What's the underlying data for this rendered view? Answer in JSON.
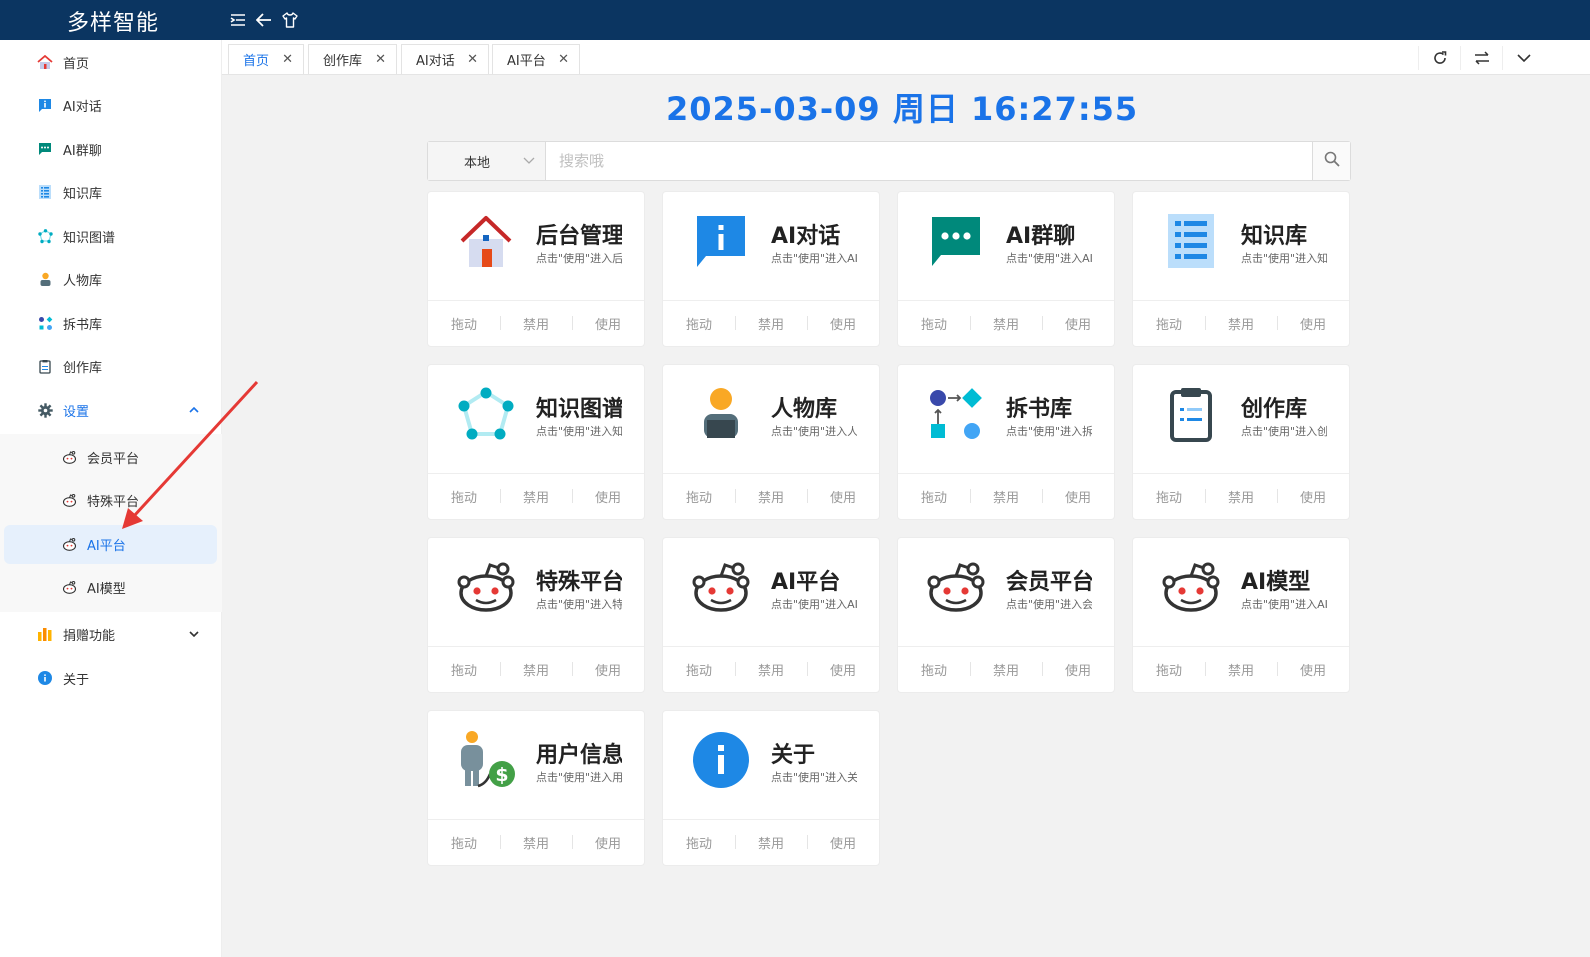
{
  "app": {
    "title": "多样智能"
  },
  "sidebar": {
    "items": [
      {
        "label": "首页",
        "icon": "home-icon"
      },
      {
        "label": "AI对话",
        "icon": "info-chat-icon"
      },
      {
        "label": "AI群聊",
        "icon": "group-chat-icon"
      },
      {
        "label": "知识库",
        "icon": "list-icon"
      },
      {
        "label": "知识图谱",
        "icon": "graph-icon"
      },
      {
        "label": "人物库",
        "icon": "person-icon"
      },
      {
        "label": "拆书库",
        "icon": "flow-icon"
      },
      {
        "label": "创作库",
        "icon": "clipboard-icon"
      },
      {
        "label": "设置",
        "icon": "gear-icon"
      },
      {
        "label": "捐赠功能",
        "icon": "bar-chart-icon"
      },
      {
        "label": "关于",
        "icon": "info-circle-icon"
      }
    ],
    "settings_sub": [
      {
        "label": "会员平台",
        "icon": "reddit-icon"
      },
      {
        "label": "特殊平台",
        "icon": "reddit-icon"
      },
      {
        "label": "AI平台",
        "icon": "reddit-icon"
      },
      {
        "label": "AI模型",
        "icon": "reddit-icon"
      }
    ]
  },
  "tabs": [
    {
      "label": "首页",
      "close": "✕"
    },
    {
      "label": "创作库",
      "close": "✕"
    },
    {
      "label": "AI对话",
      "close": "✕"
    },
    {
      "label": "AI平台",
      "close": "✕"
    }
  ],
  "clock": {
    "text": "2025-03-09 周日  16:27:55"
  },
  "search": {
    "scope": "本地",
    "placeholder": "搜索哦"
  },
  "cards": [
    {
      "title": "后台管理",
      "subtitle": "点击\"使用\"进入后台",
      "icon": "house-icon"
    },
    {
      "title": "AI对话",
      "subtitle": "点击\"使用\"进入AI对话",
      "icon": "info-chat-icon"
    },
    {
      "title": "AI群聊",
      "subtitle": "点击\"使用\"进入AI群聊",
      "icon": "group-chat-icon"
    },
    {
      "title": "知识库",
      "subtitle": "点击\"使用\"进入知识库",
      "icon": "list-icon"
    },
    {
      "title": "知识图谱",
      "subtitle": "点击\"使用\"进入知识图谱",
      "icon": "graph-icon"
    },
    {
      "title": "人物库",
      "subtitle": "点击\"使用\"进入人物库",
      "icon": "person-icon"
    },
    {
      "title": "拆书库",
      "subtitle": "点击\"使用\"进入拆书库",
      "icon": "flow-icon"
    },
    {
      "title": "创作库",
      "subtitle": "点击\"使用\"进入创作库",
      "icon": "clipboard-icon"
    },
    {
      "title": "特殊平台",
      "subtitle": "点击\"使用\"进入特殊平台",
      "icon": "reddit-icon"
    },
    {
      "title": "AI平台",
      "subtitle": "点击\"使用\"进入AI平台",
      "icon": "reddit-icon"
    },
    {
      "title": "会员平台",
      "subtitle": "点击\"使用\"进入会员平台",
      "icon": "reddit-icon"
    },
    {
      "title": "AI模型",
      "subtitle": "点击\"使用\"进入AI模型",
      "icon": "reddit-icon"
    },
    {
      "title": "用户信息",
      "subtitle": "点击\"使用\"进入用户信息",
      "icon": "user-money-icon"
    },
    {
      "title": "关于",
      "subtitle": "点击\"使用\"进入关于",
      "icon": "info-circle-icon"
    }
  ],
  "card_actions": {
    "drag": "拖动",
    "disable": "禁用",
    "use": "使用"
  },
  "colors": {
    "topbar": "#0b3561",
    "accent": "#1a73e8",
    "annotation": "#e53935"
  }
}
